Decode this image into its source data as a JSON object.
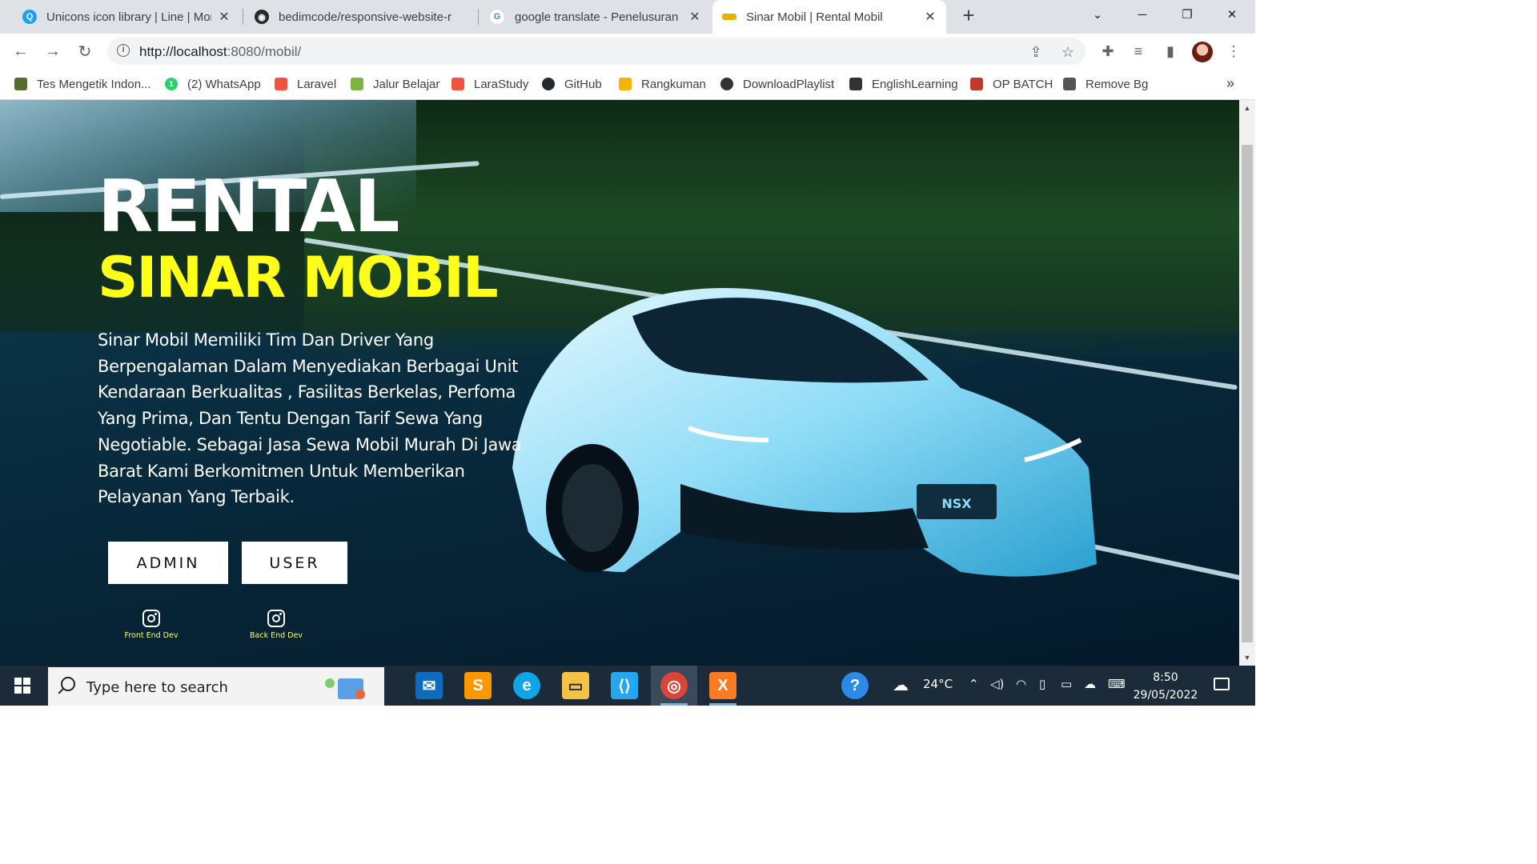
{
  "browser": {
    "tabs": [
      {
        "title": "Unicons icon library | Line | Mono",
        "icon": "search-icon",
        "color": "#1ea0f0",
        "close": "✕"
      },
      {
        "title": "bedimcode/responsive-website-r",
        "icon": "github-icon",
        "color": "#24292e",
        "close": "✕"
      },
      {
        "title": "google translate - Penelusuran G",
        "icon": "google-icon",
        "color": "#4285f4",
        "close": "✕"
      },
      {
        "title": "Sinar Mobil | Rental Mobil",
        "icon": "car-icon",
        "color": "#e8b100",
        "close": "✕"
      }
    ],
    "new_tab": "+",
    "url": {
      "host": "http://localhost",
      "rest": ":8080/mobil/"
    },
    "bookmarks": [
      {
        "label": "Tes Mengetik Indon...",
        "icon": "typing-icon",
        "color": "#556b2f"
      },
      {
        "label": "(2) WhatsApp",
        "icon": "whatsapp-icon",
        "color": "#25d366"
      },
      {
        "label": "Laravel",
        "icon": "laravel-icon",
        "color": "#f05340"
      },
      {
        "label": "Jalur Belajar",
        "icon": "learning-path-icon",
        "color": "#7cb342"
      },
      {
        "label": "LaraStudy",
        "icon": "laravel-icon",
        "color": "#f05340"
      },
      {
        "label": "GitHub",
        "icon": "github-icon",
        "color": "#24292e"
      },
      {
        "label": "Rangkuman",
        "icon": "summary-icon",
        "color": "#f4b400"
      },
      {
        "label": "DownloadPlaylist",
        "icon": "download-icon",
        "color": "#333333"
      },
      {
        "label": "EnglishLearning",
        "icon": "english-icon",
        "color": "#333333"
      },
      {
        "label": "OP BATCH",
        "icon": "anime-icon",
        "color": "#c0392b"
      },
      {
        "label": "Remove Bg",
        "icon": "remove-bg-icon",
        "color": "#555555"
      }
    ],
    "bookmarks_more": "»"
  },
  "page": {
    "title": "RENTAL",
    "subtitle": "SINAR MOBIL",
    "description": "Sinar Mobil Memiliki Tim Dan Driver Yang Berpengalaman Dalam Menyediakan Berbagai Unit Kendaraan Berkualitas , Fasilitas Berkelas, Perfoma Yang Prima, Dan Tentu Dengan Tarif Sewa Yang Negotiable. Sebagai Jasa Sewa Mobil Murah Di Jawa Barat Kami Berkomitmen Untuk Memberikan Pelayanan Yang Terbaik.",
    "buttons": {
      "admin": "ADMIN",
      "user": "USER"
    },
    "socials": [
      {
        "caption": "Front End Dev",
        "icon": "instagram-icon"
      },
      {
        "caption": "Back End Dev",
        "icon": "instagram-icon"
      }
    ],
    "car_badge": "NSX",
    "accent_color": "#ffff1a"
  },
  "taskbar": {
    "search_placeholder": "Type here to search",
    "apps": [
      {
        "name": "mail-icon",
        "color": "#0f6cbd"
      },
      {
        "name": "sublime-text-icon",
        "color": "#ff9800"
      },
      {
        "name": "edge-icon",
        "color": "#0ea5e9"
      },
      {
        "name": "file-explorer-icon",
        "color": "#f5c242"
      },
      {
        "name": "vscode-icon",
        "color": "#23a7f2"
      },
      {
        "name": "chrome-icon",
        "color": "#db4437"
      },
      {
        "name": "xampp-icon",
        "color": "#fb7a24"
      }
    ],
    "weather": "24°C",
    "time": "8:50",
    "date": "29/05/2022"
  }
}
